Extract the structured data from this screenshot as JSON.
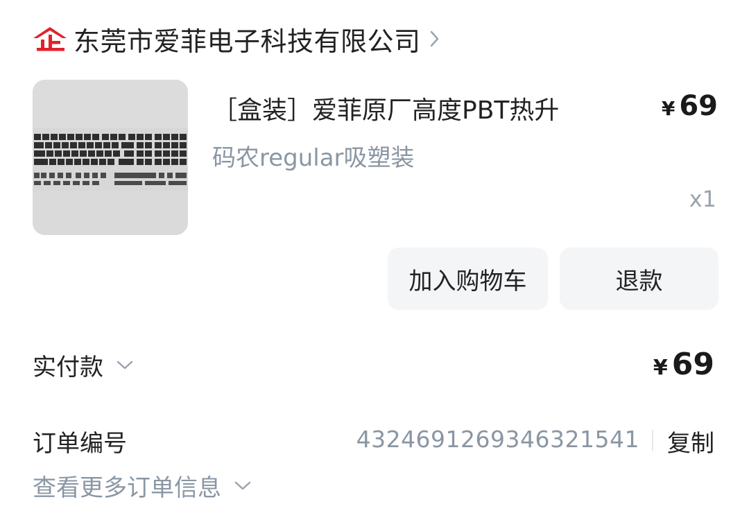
{
  "shop": {
    "name": "东莞市爱菲电子科技有限公司",
    "logo_icon": "enterprise-icon",
    "chevron_icon": "chevron-right-icon",
    "brand_color": "#e4202b"
  },
  "product": {
    "title": "［盒装］爱菲原厂高度PBT热升",
    "variant": "码农regular吸塑装",
    "price_symbol": "¥",
    "price": "69",
    "quantity": "x1",
    "image_icon": "keycap-set-image"
  },
  "actions": {
    "add_to_cart": "加入购物车",
    "refund": "退款"
  },
  "payment": {
    "label": "实付款",
    "symbol": "¥",
    "amount": "69",
    "chevron_icon": "chevron-down-icon"
  },
  "order": {
    "number_label": "订单编号",
    "number": "4324691269346321541",
    "copy_label": "复制",
    "more_info_label": "查看更多订单信息"
  },
  "colors": {
    "text_primary": "#222222",
    "text_secondary": "#8a96a3",
    "button_bg": "#f3f5f7"
  }
}
